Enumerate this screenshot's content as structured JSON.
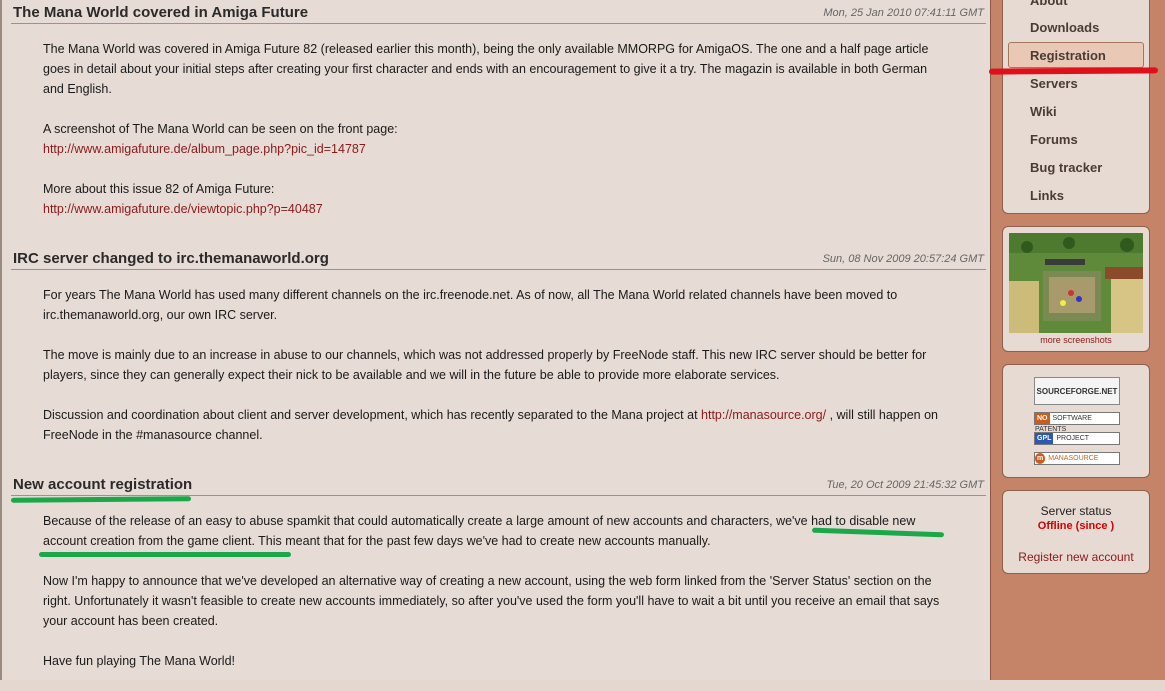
{
  "news": [
    {
      "title": "The Mana World covered in Amiga Future",
      "date": "Mon, 25 Jan 2010 07:41:11 GMT",
      "p1": "The Mana World was covered in Amiga Future 82 (released earlier this month), being the only available MMORPG for AmigaOS. The one and a half page article goes in detail about your initial steps after creating your first character and ends with an encouragement to give it a try. The magazin is available in both German and English.",
      "p2_text": "A screenshot of The Mana World can be seen on the front page:",
      "p2_link": "http://www.amigafuture.de/album_page.php?pic_id=14787",
      "p3_text": "More about this issue 82 of Amiga Future:",
      "p3_link": "http://www.amigafuture.de/viewtopic.php?p=40487"
    },
    {
      "title": "IRC server changed to irc.themanaworld.org",
      "date": "Sun, 08 Nov 2009 20:57:24 GMT",
      "p1": "For years The Mana World has used many different channels on the irc.freenode.net. As of now, all The Mana World related channels have been moved to irc.themanaworld.org, our own IRC server.",
      "p2": "The move is mainly due to an increase in abuse to our channels, which was not addressed properly by FreeNode staff. This new IRC server should be better for players, since they can generally expect their nick to be available and we will in the future be able to provide more elaborate services.",
      "p3_before": "Discussion and coordination about client and server development, which has recently separated to the Mana project at ",
      "p3_link": "http://manasource.org/",
      "p3_after": " , will still happen on FreeNode in the #manasource channel."
    },
    {
      "title": "New account registration",
      "date": "Tue, 20 Oct 2009 21:45:32 GMT",
      "p1": "Because of the release of an easy to abuse spamkit that could automatically create a large amount of new accounts and characters, we've had to disable new account creation from the game client. This meant that for the past few days we've had to create new accounts manually.",
      "p2": "Now I'm happy to announce that we've developed an alternative way of creating a new account, using the web form linked from the 'Server Status' section on the right. Unfortunately it wasn't feasible to create new accounts immediately, so after you've used the form you'll have to wait a bit until you receive an email that says your account has been created.",
      "p3": "Have fun playing The Mana World!"
    }
  ],
  "nav": {
    "items": [
      "About",
      "Downloads",
      "Registration",
      "Servers",
      "Wiki",
      "Forums",
      "Bug tracker",
      "Links"
    ],
    "selected": "Registration"
  },
  "screenshots": {
    "link": "more screenshots"
  },
  "badges": {
    "sourceforge": "SOURCEFORGE.NET",
    "nopatents_tag": "NO",
    "nopatents_text": "SOFTWARE PATENTS",
    "gpl_tag": "GPL",
    "gpl_text": "PROJECT",
    "mana_tag": "m",
    "mana_text": "MANASOURCE"
  },
  "server": {
    "label": "Server status",
    "status": "Offline (since )",
    "register": "Register new account"
  },
  "colors": {
    "annotation_green": "#1aa84a",
    "annotation_red": "#e0101a",
    "link": "#8a1a1a",
    "offline": "#d40000"
  }
}
